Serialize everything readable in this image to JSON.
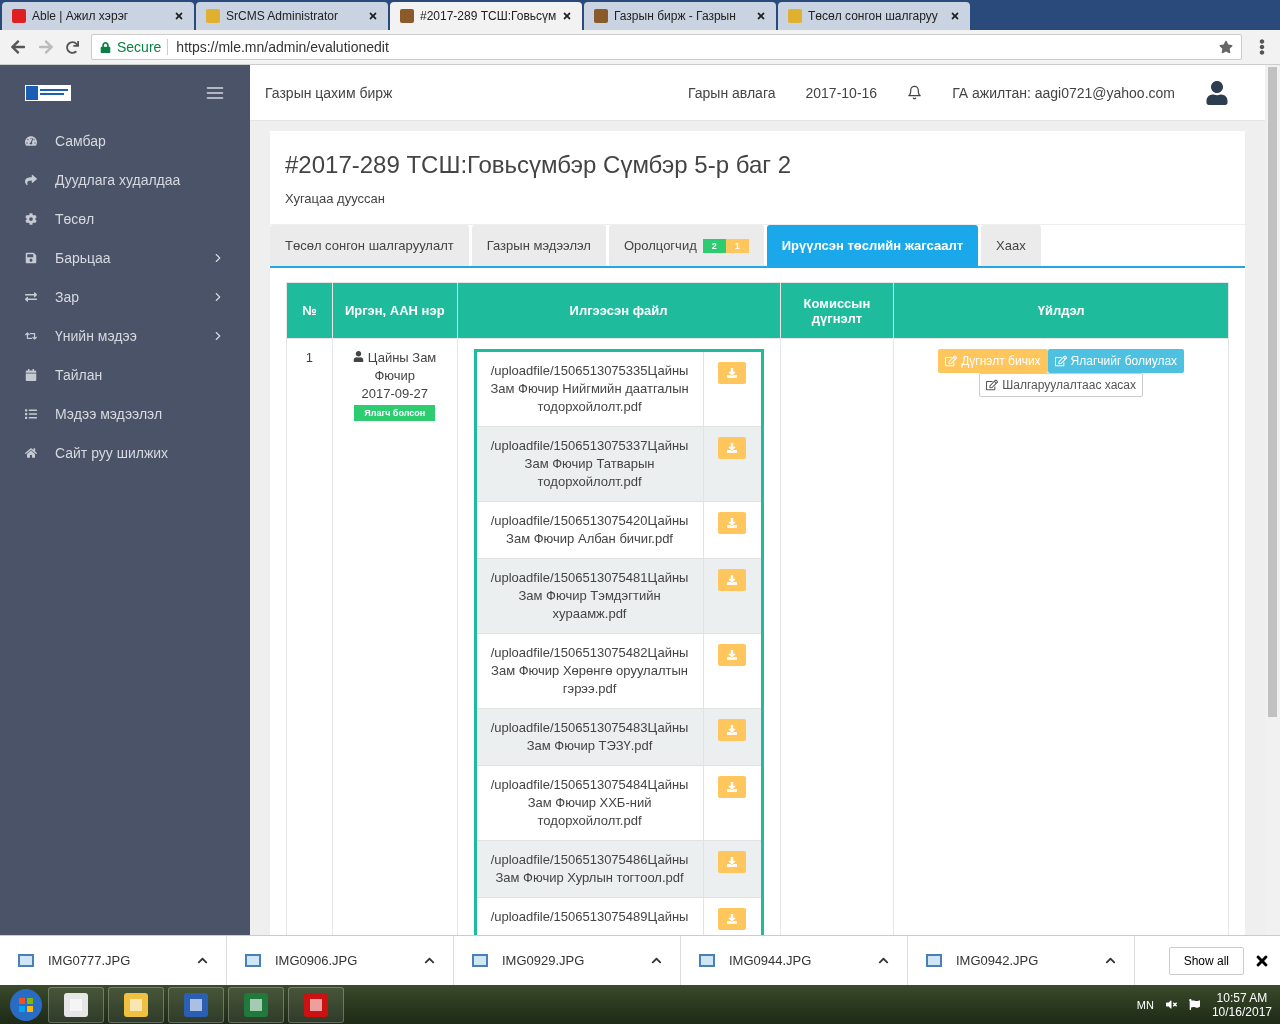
{
  "browser": {
    "tabs": [
      {
        "title": "Able | Ажил хэрэг",
        "selected": false
      },
      {
        "title": "SrCMS Administrator",
        "selected": false
      },
      {
        "title": "#2017-289 ТСШ:Говьсүм",
        "selected": true
      },
      {
        "title": "Газрын бирж - Газрын",
        "selected": false
      },
      {
        "title": "Төсөл сонгон шалгаруу",
        "selected": false
      }
    ],
    "secure_label": "Secure",
    "url": "https://mle.mn/admin/evalutionedit"
  },
  "sidebar": {
    "items": [
      {
        "label": "Самбар",
        "expandable": false
      },
      {
        "label": "Дуудлага худалдаа",
        "expandable": false
      },
      {
        "label": "Төсөл",
        "expandable": false
      },
      {
        "label": "Барьцаа",
        "expandable": true
      },
      {
        "label": "Зар",
        "expandable": true
      },
      {
        "label": "Үнийн мэдээ",
        "expandable": true
      },
      {
        "label": "Тайлан",
        "expandable": false
      },
      {
        "label": "Мэдээ мэдээлэл",
        "expandable": false
      },
      {
        "label": "Сайт руу шилжих",
        "expandable": false
      }
    ]
  },
  "header": {
    "site_title": "Газрын цахим бирж",
    "guide_link": "Гарын авлага",
    "date": "2017-10-16",
    "user": "ГА ажилтан: aagi0721@yahoo.com"
  },
  "card": {
    "title": "#2017-289 ТСШ:Говьсүмбэр Сүмбэр 5-р баг 2",
    "status": "Хугацаа дууссан",
    "tabs": [
      {
        "label": "Төсөл сонгон шалгаруулалт",
        "selected": false
      },
      {
        "label": "Газрын мэдээлэл",
        "selected": false
      },
      {
        "label": "Оролцогчид",
        "selected": false,
        "badges": [
          {
            "text": "2",
            "color": "#2ecc71"
          },
          {
            "text": "1",
            "color": "#ffc65d"
          }
        ]
      },
      {
        "label": "Ирүүлсэн төслийн жагсаалт",
        "selected": true
      },
      {
        "label": "Хаах",
        "selected": false
      }
    ],
    "table": {
      "columns": [
        "№",
        "Иргэн, ААН нэр",
        "Илгээсэн файл",
        "Комиссын дүгнэлт",
        "Үйлдэл"
      ],
      "rows": [
        {
          "number": "1",
          "applicant": "Цайны Зам Фючир",
          "date": "2017-09-27",
          "badge": "Ялагч болсон",
          "files": [
            "/uploadfile/1506513075335Цайны Зам Фючир Нийгмийн даатгалын тодорхойлолт.pdf",
            "/uploadfile/1506513075337Цайны Зам Фючир Татварын тодорхойлолт.pdf",
            "/uploadfile/1506513075420Цайны Зам Фючир Албан бичиг.pdf",
            "/uploadfile/1506513075481Цайны Зам Фючир Тэмдэгтийн хураамж.pdf",
            "/uploadfile/1506513075482Цайны Зам Фючир Хөрөнгө оруулалтын гэрээ.pdf",
            "/uploadfile/1506513075483Цайны Зам Фючир ТЭЗҮ.pdf",
            "/uploadfile/1506513075484Цайны Зам Фючир ХХБ-ний тодорхойлолт.pdf",
            "/uploadfile/1506513075486Цайны Зам Фючир Хурлын тогтоол.pdf",
            "/uploadfile/1506513075489Цайны"
          ],
          "actions": [
            {
              "label": "Дүгнэлт бичих",
              "kind": "warning"
            },
            {
              "label": "Ялагчийг болиулах",
              "kind": "info"
            },
            {
              "label": "Шалгаруулалтаас хасах",
              "kind": "default"
            }
          ]
        }
      ]
    }
  },
  "downloads": {
    "files": [
      "IMG0777.JPG",
      "IMG0906.JPG",
      "IMG0929.JPG",
      "IMG0944.JPG",
      "IMG0942.JPG"
    ],
    "show_all": "Show all"
  },
  "taskbar": {
    "language": "MN",
    "time": "10:57 AM",
    "date": "10/16/2017"
  }
}
